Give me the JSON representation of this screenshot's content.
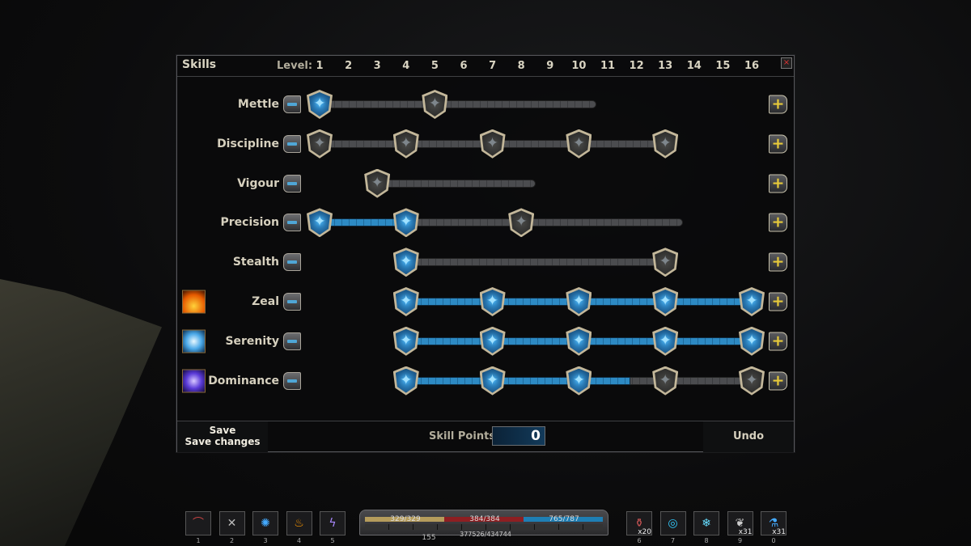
{
  "panel": {
    "title": "Skills",
    "level_label": "Level:",
    "levels": [
      "1",
      "2",
      "3",
      "4",
      "5",
      "6",
      "7",
      "8",
      "9",
      "10",
      "11",
      "12",
      "13",
      "14",
      "15",
      "16"
    ],
    "close_label": "×"
  },
  "skills": [
    {
      "name": "Mettle",
      "icon": null,
      "nodes": [
        {
          "level": 1,
          "active": true
        },
        {
          "level": 5,
          "active": false
        }
      ],
      "bar_end": 10.6,
      "filled_to": 1
    },
    {
      "name": "Discipline",
      "icon": null,
      "nodes": [
        {
          "level": 1,
          "active": false
        },
        {
          "level": 4,
          "active": false
        },
        {
          "level": 7,
          "active": false
        },
        {
          "level": 10,
          "active": false
        },
        {
          "level": 13,
          "active": false
        }
      ],
      "bar_end": 13,
      "filled_to": null
    },
    {
      "name": "Vigour",
      "icon": null,
      "nodes": [
        {
          "level": 3,
          "active": false
        }
      ],
      "bar_end": 8.5,
      "filled_to": null
    },
    {
      "name": "Precision",
      "icon": null,
      "nodes": [
        {
          "level": 1,
          "active": true
        },
        {
          "level": 4,
          "active": true
        },
        {
          "level": 8,
          "active": false
        }
      ],
      "bar_end": 13.6,
      "filled_to": 4
    },
    {
      "name": "Stealth",
      "icon": null,
      "nodes": [
        {
          "level": 4,
          "active": true
        },
        {
          "level": 13,
          "active": false
        }
      ],
      "bar_end": 13,
      "filled_to": 4
    },
    {
      "name": "Zeal",
      "icon": "fire-icon",
      "nodes": [
        {
          "level": 4,
          "active": true
        },
        {
          "level": 7,
          "active": true
        },
        {
          "level": 10,
          "active": true
        },
        {
          "level": 13,
          "active": true
        },
        {
          "level": 16,
          "active": true
        }
      ],
      "bar_end": 16,
      "filled_to": 16
    },
    {
      "name": "Serenity",
      "icon": "frost-icon",
      "nodes": [
        {
          "level": 4,
          "active": true
        },
        {
          "level": 7,
          "active": true
        },
        {
          "level": 10,
          "active": true
        },
        {
          "level": 13,
          "active": true
        },
        {
          "level": 16,
          "active": true
        }
      ],
      "bar_end": 16,
      "filled_to": 16
    },
    {
      "name": "Dominance",
      "icon": "lightning-icon",
      "nodes": [
        {
          "level": 4,
          "active": true
        },
        {
          "level": 7,
          "active": true
        },
        {
          "level": 10,
          "active": true
        },
        {
          "level": 13,
          "active": false
        },
        {
          "level": 16,
          "active": false
        }
      ],
      "bar_end": 16,
      "filled_to": 11.8
    }
  ],
  "footer": {
    "save_label": "Save",
    "save_tooltip": "Save changes",
    "skill_points_label": "Skill Points",
    "skill_points": "0",
    "undo_label": "Undo"
  },
  "hotbar": {
    "left": [
      {
        "key": "1",
        "icon": "scythe-icon",
        "glyph": "⌒",
        "color": "#c44"
      },
      {
        "key": "2",
        "icon": "crossbow-icon",
        "glyph": "✕",
        "color": "#bbb"
      },
      {
        "key": "3",
        "icon": "frost-burst-icon",
        "glyph": "✺",
        "color": "#4af"
      },
      {
        "key": "4",
        "icon": "fire-icon",
        "glyph": "♨",
        "color": "#f90"
      },
      {
        "key": "5",
        "icon": "lightning-icon",
        "glyph": "ϟ",
        "color": "#a8f"
      }
    ],
    "right": [
      {
        "key": "6",
        "icon": "potion-jar-icon",
        "glyph": "⚱",
        "color": "#c55",
        "count": "x20"
      },
      {
        "key": "7",
        "icon": "target-rune-icon",
        "glyph": "◎",
        "color": "#3cf",
        "count": ""
      },
      {
        "key": "8",
        "icon": "snowflake-rune-icon",
        "glyph": "❄",
        "color": "#6df",
        "count": ""
      },
      {
        "key": "9",
        "icon": "scroll-icon",
        "glyph": "❦",
        "color": "#ccc",
        "count": "x31"
      },
      {
        "key": "0",
        "icon": "mana-flask-icon",
        "glyph": "⚗",
        "color": "#4af",
        "count": "x31"
      }
    ],
    "stamina": "329/329",
    "health": "384/384",
    "mana": "765/787",
    "stamina_color": "#b59c5c",
    "health_color": "#8e1f22",
    "mana_color": "#1f7fb4",
    "experience": "377526/434744",
    "level": "155"
  }
}
